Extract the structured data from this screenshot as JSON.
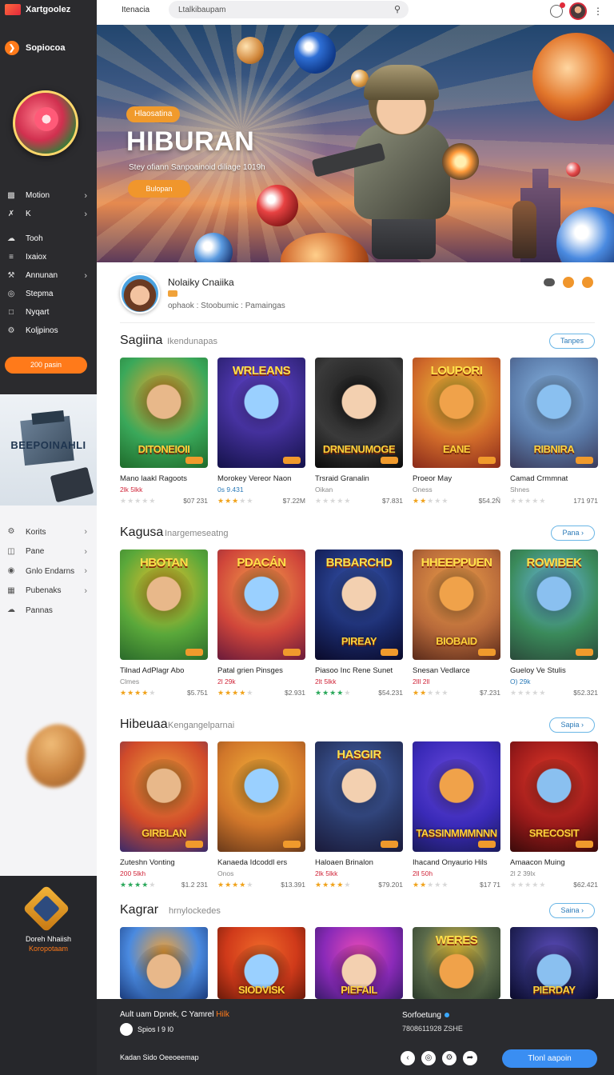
{
  "sidebar": {
    "logo": "Xartgoolez",
    "brand": "Sopiocoa",
    "nav": [
      {
        "label": "Motion",
        "icon": "gamepad-icon",
        "chev": true
      },
      {
        "label": "K",
        "icon": "tools-icon",
        "chev": true
      },
      {
        "label": "Tooh",
        "icon": "cloud-icon",
        "chev": false
      },
      {
        "label": "Ixaiox",
        "icon": "list-icon",
        "chev": false
      },
      {
        "label": "Annunan",
        "icon": "wrench-icon",
        "chev": true
      },
      {
        "label": "Stepma",
        "icon": "target-icon",
        "chev": false
      },
      {
        "label": "Nyqart",
        "icon": "chat-icon",
        "chev": false
      },
      {
        "label": "Koljpinos",
        "icon": "settings-icon",
        "chev": false
      }
    ],
    "cta": "200 pasin",
    "promo_text": "BEEPOINAHLI",
    "nav2": [
      {
        "label": "Korits",
        "icon": "gear-icon",
        "chev": true
      },
      {
        "label": "Pane",
        "icon": "folder-icon",
        "chev": true
      },
      {
        "label": "Gnlo Endarns",
        "icon": "tag-icon",
        "chev": true
      },
      {
        "label": "Pubenaks",
        "icon": "grid-icon",
        "chev": true
      },
      {
        "label": "Pannas",
        "icon": "cloud-outline-icon",
        "chev": false
      }
    ],
    "footer_line1": "Doreh Nhaiish",
    "footer_line2": "Koropotaam"
  },
  "topbar": {
    "home": "Itenacia",
    "search_text": "Ltalkibaupam"
  },
  "hero": {
    "pill": "Hlaosatina",
    "title": "HIBURAN",
    "subtitle": "Stey ofiann Sanpoainoid diliage 1019h",
    "button": "Bulopan"
  },
  "profile": {
    "name": "Nolaiky Cnaiika",
    "meta": "ophaok : Stoobumic : Pamaingas"
  },
  "sections": [
    {
      "title": "Sagiina",
      "subtitle": "Ikendunapas",
      "more": "Tanpes",
      "cards": [
        {
          "top": "",
          "cap": "DITONEIOII",
          "title": "Mano laakl Ragoots",
          "sub": "2lk 5lkk",
          "sub_color": "red",
          "stars": 0,
          "star_style": "",
          "price": "$07 231"
        },
        {
          "top": "WRLEANS",
          "cap": "",
          "title": "Morokey Vereor Naon",
          "sub": "0s 9.431",
          "sub_color": "blue",
          "stars": 3,
          "star_style": "",
          "price": "$7.22M"
        },
        {
          "top": "",
          "cap": "DRNENUMOGE",
          "title": "Trsraid Granalin",
          "sub": "Oikan",
          "sub_color": "",
          "stars": 0,
          "star_style": "",
          "price": "$7.831"
        },
        {
          "top": "LOUPORI",
          "cap": "EANE",
          "title": "Proeor May",
          "sub": "Oness",
          "sub_color": "",
          "stars": 2,
          "star_style": "",
          "price": "$54.2Ñ"
        },
        {
          "top": "",
          "cap": "RIBNIRA",
          "title": "Camad Crmmnat",
          "sub": "Shnes",
          "sub_color": "",
          "stars": 0,
          "star_style": "",
          "price": "171 971"
        }
      ]
    },
    {
      "title": "Kagusa",
      "subtitle": "Inargemeseatng",
      "more": "Pana",
      "cards": [
        {
          "top": "HBOTAN",
          "cap": "",
          "title": "Tilnad AdPlagr Abo",
          "sub": "Clmes",
          "sub_color": "",
          "stars": 4,
          "star_style": "",
          "price": "$5.751"
        },
        {
          "top": "PDACÁN",
          "cap": "",
          "title": "Patal grien Pinsges",
          "sub": "2l 29k",
          "sub_color": "red",
          "stars": 4,
          "star_style": "",
          "price": "$2.931"
        },
        {
          "top": "BRBARCHD",
          "cap": "PIREAY",
          "title": "Piasoo Inc Rene Sunet",
          "sub": "2lt 5lkk",
          "sub_color": "red",
          "stars": 4,
          "star_style": "green",
          "price": "$54.231"
        },
        {
          "top": "HHEEPPUEN",
          "cap": "BIOBAID",
          "title": "Snesan Vedlarce",
          "sub": "2lll 2ll",
          "sub_color": "red",
          "stars": 2,
          "star_style": "",
          "price": "$7.231"
        },
        {
          "top": "ROWIBEK",
          "cap": "",
          "title": "Gueloy Ve Stulis",
          "sub": "O) 29k",
          "sub_color": "blue",
          "stars": 0,
          "star_style": "",
          "price": "$52.321"
        }
      ]
    },
    {
      "title": "Hibeuaa",
      "subtitle": "Kengangelparnai",
      "more": "Sapia",
      "cards": [
        {
          "top": "",
          "cap": "GIRBLAN",
          "title": "Zuteshn Vonting",
          "sub": "200 5lkh",
          "sub_color": "red",
          "stars": 4,
          "star_style": "green",
          "price": "$1.2 231"
        },
        {
          "top": "",
          "cap": "",
          "title": "Kanaeda Idcoddl ers",
          "sub": "Onos",
          "sub_color": "",
          "stars": 4,
          "star_style": "",
          "price": "$13.391"
        },
        {
          "top": "HASGIR",
          "cap": "",
          "title": "Haloaen Brinalon",
          "sub": "2lk 5lkk",
          "sub_color": "red",
          "stars": 4,
          "star_style": "",
          "price": "$79.201"
        },
        {
          "top": "",
          "cap": "TASSINMMMNNN",
          "title": "Ihacand Onyaurio Hils",
          "sub": "2ll 50h",
          "sub_color": "red",
          "stars": 2,
          "star_style": "",
          "price": "$17 71"
        },
        {
          "top": "",
          "cap": "SRECOSIT",
          "title": "Amaacon Muing",
          "sub": "2l 2 39lx",
          "sub_color": "",
          "stars": 0,
          "star_style": "",
          "price": "$62.421"
        }
      ]
    },
    {
      "title": "Kagrar",
      "subtitle": "hrnylockedes",
      "more": "Saina",
      "cards": [
        {
          "top": "",
          "cap": "",
          "title": "",
          "sub": "",
          "sub_color": "",
          "stars": 0,
          "star_style": "",
          "price": ""
        },
        {
          "top": "",
          "cap": "SIODVISK",
          "title": "",
          "sub": "",
          "sub_color": "",
          "stars": 0,
          "star_style": "",
          "price": ""
        },
        {
          "top": "",
          "cap": "PIEFAIL",
          "title": "",
          "sub": "",
          "sub_color": "",
          "stars": 0,
          "star_style": "",
          "price": ""
        },
        {
          "top": "WERES",
          "cap": "",
          "title": "",
          "sub": "",
          "sub_color": "",
          "stars": 0,
          "star_style": "",
          "price": ""
        },
        {
          "top": "",
          "cap": "PIERDAY",
          "title": "",
          "sub": "",
          "sub_color": "",
          "stars": 0,
          "star_style": "",
          "price": ""
        }
      ]
    }
  ],
  "bottombar": {
    "line1": "Ault uam Dpnek, C Yamrel",
    "line1_highlight": "Hilk",
    "line2": "Spios I 9 I0",
    "line3": "Kadan Sido Oeeoeemap",
    "right1": "Sorfoetung",
    "right2": "7808611928 ZSHE",
    "cta": "Tlonl aapoin"
  },
  "colors": {
    "accent": "#f0962c",
    "sidebar_dark": "#2b2b2e",
    "link": "#2a7ab8",
    "cta_blue": "#3a8ef2"
  }
}
